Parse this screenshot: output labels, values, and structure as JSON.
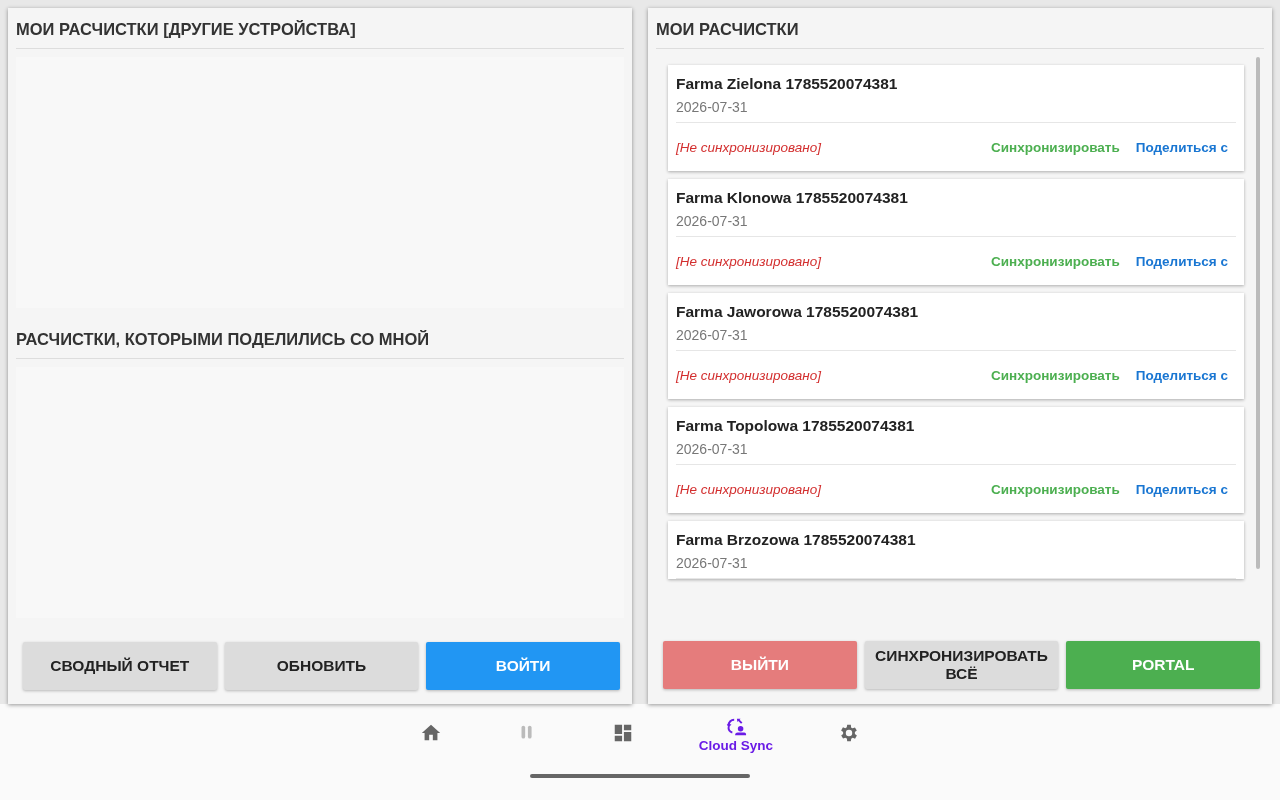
{
  "left_panel": {
    "sections": [
      {
        "title": "МОИ РАСЧИСТКИ [ДРУГИЕ УСТРОЙСТВА]"
      },
      {
        "title": "РАСЧИСТКИ, КОТОРЫМИ ПОДЕЛИЛИСЬ СО МНОЙ"
      }
    ],
    "buttons": [
      {
        "label": "СВОДНЫЙ ОТЧЕТ",
        "kind": "neutral"
      },
      {
        "label": "ОБНОВИТЬ",
        "kind": "neutral"
      },
      {
        "label": "ВОЙТИ",
        "kind": "primary"
      }
    ]
  },
  "right_panel": {
    "title": "МОИ РАСЧИСТКИ",
    "items": [
      {
        "name": "Farma Zielona 1785520074381",
        "date": "2026-07-31",
        "status": "[Не синхронизировано]",
        "sync_action": "Синхронизировать",
        "share_action": "Поделиться с"
      },
      {
        "name": "Farma Klonowa 1785520074381",
        "date": "2026-07-31",
        "status": "[Не синхронизировано]",
        "sync_action": "Синхронизировать",
        "share_action": "Поделиться с"
      },
      {
        "name": "Farma Jaworowa 1785520074381",
        "date": "2026-07-31",
        "status": "[Не синхронизировано]",
        "sync_action": "Синхронизировать",
        "share_action": "Поделиться с"
      },
      {
        "name": "Farma Topolowa 1785520074381",
        "date": "2026-07-31",
        "status": "[Не синхронизировано]",
        "sync_action": "Синхронизировать",
        "share_action": "Поделиться с"
      },
      {
        "name": "Farma Brzozowa 1785520074381",
        "date": "2026-07-31"
      }
    ],
    "buttons": [
      {
        "label": "ВЫЙТИ",
        "kind": "danger"
      },
      {
        "label": "СИНХРОНИЗИРОВАТЬ ВСЁ",
        "kind": "neutral"
      },
      {
        "label": "PORTAL",
        "kind": "success"
      }
    ]
  },
  "bottom_nav": [
    {
      "kind": "home",
      "selected": false,
      "disabled": false
    },
    {
      "kind": "pause",
      "selected": false,
      "disabled": true
    },
    {
      "kind": "dashboard",
      "selected": false,
      "disabled": false
    },
    {
      "kind": "cloud_sync",
      "label": "Cloud Sync",
      "selected": true,
      "disabled": false
    },
    {
      "kind": "settings",
      "selected": false,
      "disabled": false
    }
  ]
}
